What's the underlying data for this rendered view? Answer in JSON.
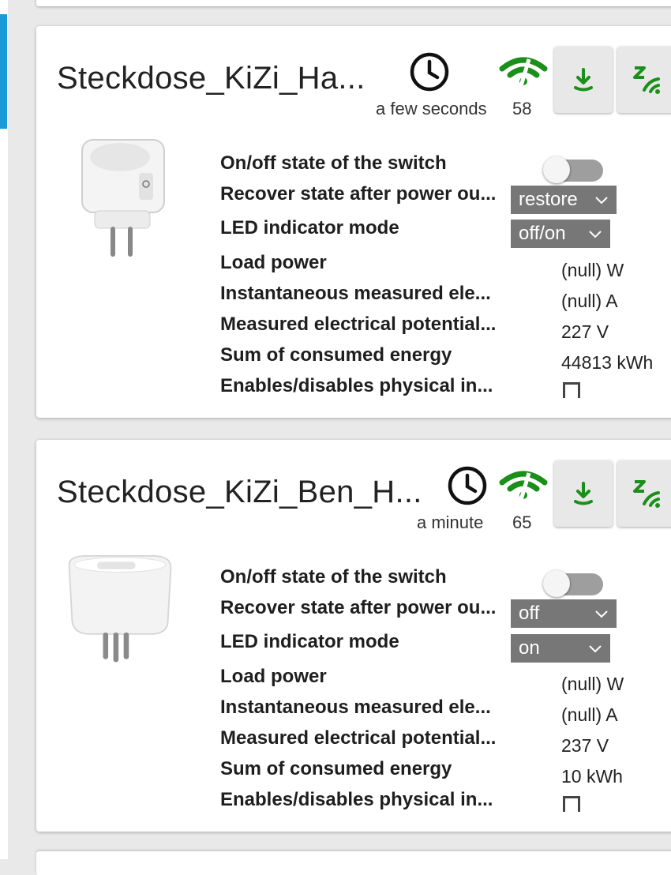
{
  "colors": {
    "accent": "#1a9bd7",
    "signal_green": "#1a8f1a",
    "select_bg": "#777777",
    "button_bg": "#e8e8e8"
  },
  "devices": [
    {
      "title": "Steckdose_KiZi_Ha...",
      "last_seen": "a few seconds",
      "link_quality": "58",
      "icons": {
        "clock": "clock-icon",
        "signal": "wifi-signal-icon",
        "update": "download-icon",
        "info": "zigbee-info-icon"
      },
      "states": [
        {
          "label": "On/off state of the switch",
          "type": "toggle",
          "checked": false
        },
        {
          "label": "Recover state after power ou...",
          "type": "select",
          "value": "restore"
        },
        {
          "label": "LED indicator mode",
          "type": "select",
          "value": "off/on"
        },
        {
          "label": "Load power",
          "type": "value",
          "value": "(null) W"
        },
        {
          "label": "Instantaneous measured ele...",
          "type": "value",
          "value": "(null) A"
        },
        {
          "label": "Measured electrical potential...",
          "type": "value",
          "value": "227 V"
        },
        {
          "label": "Sum of consumed energy",
          "type": "value",
          "value": "44813 kWh"
        },
        {
          "label": "Enables/disables physical in...",
          "type": "checkbox",
          "checked": false
        }
      ]
    },
    {
      "title": "Steckdose_KiZi_Ben_H...",
      "last_seen": "a minute",
      "link_quality": "65",
      "icons": {
        "clock": "clock-icon",
        "signal": "wifi-signal-icon",
        "update": "download-icon",
        "info": "zigbee-info-icon"
      },
      "states": [
        {
          "label": "On/off state of the switch",
          "type": "toggle",
          "checked": false
        },
        {
          "label": "Recover state after power ou...",
          "type": "select",
          "value": "off"
        },
        {
          "label": "LED indicator mode",
          "type": "select",
          "value": "on"
        },
        {
          "label": "Load power",
          "type": "value",
          "value": "(null) W"
        },
        {
          "label": "Instantaneous measured ele...",
          "type": "value",
          "value": "(null) A"
        },
        {
          "label": "Measured electrical potential...",
          "type": "value",
          "value": "237 V"
        },
        {
          "label": "Sum of consumed energy",
          "type": "value",
          "value": "10 kWh"
        },
        {
          "label": "Enables/disables physical in...",
          "type": "checkbox",
          "checked": false
        }
      ]
    }
  ]
}
